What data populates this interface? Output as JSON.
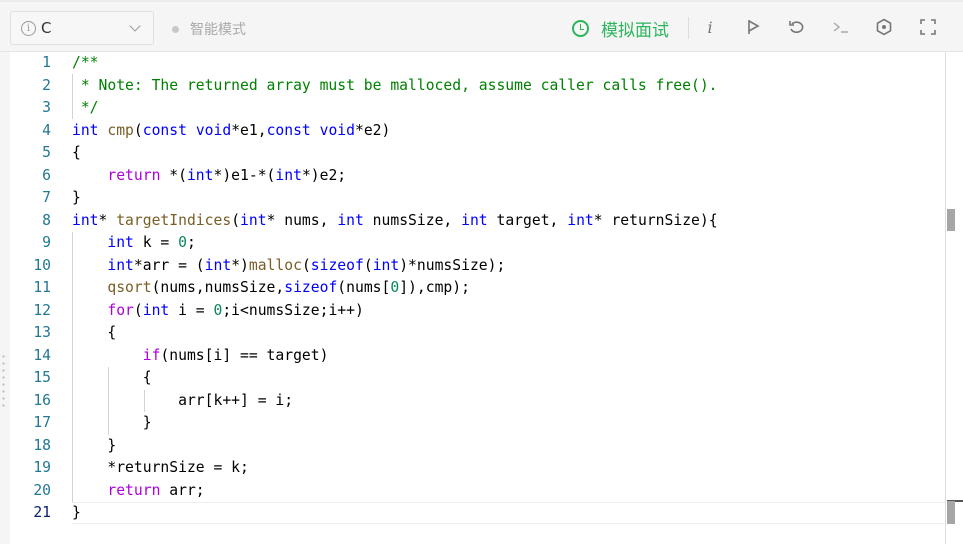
{
  "toolbar": {
    "language": "C",
    "language_icon": "info-circle-icon",
    "smart_mode": "智能模式",
    "mock_interview": "模拟面试",
    "accent": "#2db55d",
    "icons": [
      "info-icon",
      "flag-icon",
      "reset-icon",
      "console-icon",
      "settings-icon",
      "fullscreen-icon"
    ]
  },
  "editor": {
    "active_line": 21,
    "lines": [
      [
        [
          "c",
          "/**"
        ]
      ],
      [
        [
          "c",
          " * Note: The returned array must be malloced, assume caller calls free()."
        ]
      ],
      [
        [
          "c",
          " */"
        ]
      ],
      [
        [
          "k",
          "int"
        ],
        [
          "p",
          " "
        ],
        [
          "f",
          "cmp"
        ],
        [
          "p",
          "("
        ],
        [
          "k",
          "const"
        ],
        [
          "p",
          " "
        ],
        [
          "k",
          "void"
        ],
        [
          "p",
          "*e1,"
        ],
        [
          "k",
          "const"
        ],
        [
          "p",
          " "
        ],
        [
          "k",
          "void"
        ],
        [
          "p",
          "*e2)"
        ]
      ],
      [
        [
          "p",
          "{"
        ]
      ],
      [
        [
          "p",
          "    "
        ],
        [
          "x",
          "return"
        ],
        [
          "p",
          " *("
        ],
        [
          "k",
          "int"
        ],
        [
          "p",
          "*)e1-*("
        ],
        [
          "k",
          "int"
        ],
        [
          "p",
          "*)e2;"
        ]
      ],
      [
        [
          "p",
          "}"
        ]
      ],
      [
        [
          "k",
          "int"
        ],
        [
          "p",
          "* "
        ],
        [
          "f",
          "targetIndices"
        ],
        [
          "p",
          "("
        ],
        [
          "k",
          "int"
        ],
        [
          "p",
          "* nums, "
        ],
        [
          "k",
          "int"
        ],
        [
          "p",
          " numsSize, "
        ],
        [
          "k",
          "int"
        ],
        [
          "p",
          " target, "
        ],
        [
          "k",
          "int"
        ],
        [
          "p",
          "* returnSize){"
        ]
      ],
      [
        [
          "p",
          "    "
        ],
        [
          "k",
          "int"
        ],
        [
          "p",
          " k = "
        ],
        [
          "n",
          "0"
        ],
        [
          "p",
          ";"
        ]
      ],
      [
        [
          "p",
          "    "
        ],
        [
          "k",
          "int"
        ],
        [
          "p",
          "*arr = ("
        ],
        [
          "k",
          "int"
        ],
        [
          "p",
          "*)"
        ],
        [
          "f",
          "malloc"
        ],
        [
          "p",
          "("
        ],
        [
          "k",
          "sizeof"
        ],
        [
          "p",
          "("
        ],
        [
          "k",
          "int"
        ],
        [
          "p",
          ")*numsSize);"
        ]
      ],
      [
        [
          "p",
          "    "
        ],
        [
          "f",
          "qsort"
        ],
        [
          "p",
          "(nums,numsSize,"
        ],
        [
          "k",
          "sizeof"
        ],
        [
          "p",
          "(nums["
        ],
        [
          "n",
          "0"
        ],
        [
          "p",
          "]),cmp);"
        ]
      ],
      [
        [
          "p",
          "    "
        ],
        [
          "x",
          "for"
        ],
        [
          "p",
          "("
        ],
        [
          "k",
          "int"
        ],
        [
          "p",
          " i = "
        ],
        [
          "n",
          "0"
        ],
        [
          "p",
          ";i<numsSize;i++)"
        ]
      ],
      [
        [
          "p",
          "    {"
        ]
      ],
      [
        [
          "p",
          "        "
        ],
        [
          "x",
          "if"
        ],
        [
          "p",
          "(nums[i] == target)"
        ]
      ],
      [
        [
          "p",
          "        {"
        ]
      ],
      [
        [
          "p",
          "            arr[k++] = i;"
        ]
      ],
      [
        [
          "p",
          "        }"
        ]
      ],
      [
        [
          "p",
          "    }"
        ]
      ],
      [
        [
          "p",
          "    *returnSize = k;"
        ]
      ],
      [
        [
          "p",
          "    "
        ],
        [
          "x",
          "return"
        ],
        [
          "p",
          " arr;"
        ]
      ],
      [
        [
          "p",
          "}"
        ]
      ]
    ]
  }
}
